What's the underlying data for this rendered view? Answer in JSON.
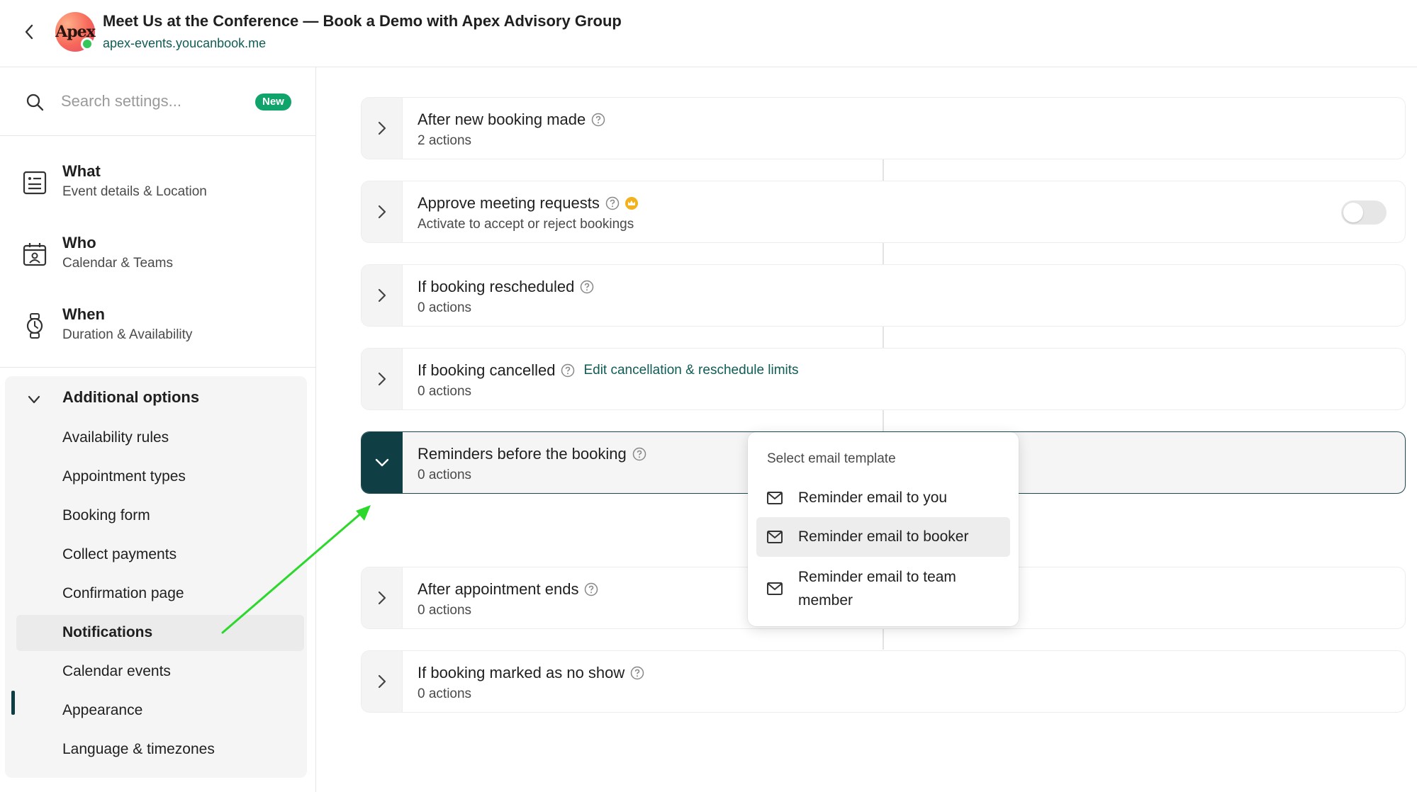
{
  "header": {
    "title": "Meet Us at the Conference — Book a Demo with Apex Advisory Group",
    "url": "apex-events.youcanbook.me",
    "avatar_text": "Apex"
  },
  "sidebar": {
    "search_placeholder": "Search settings...",
    "new_badge": "New",
    "main_items": [
      {
        "title": "What",
        "subtitle": "Event details & Location",
        "icon": "document-icon"
      },
      {
        "title": "Who",
        "subtitle": "Calendar & Teams",
        "icon": "calendar-user-icon"
      },
      {
        "title": "When",
        "subtitle": "Duration & Availability",
        "icon": "watch-icon"
      }
    ],
    "additional_label": "Additional options",
    "additional_items": [
      "Availability rules",
      "Appointment types",
      "Booking form",
      "Collect payments",
      "Confirmation page",
      "Notifications",
      "Calendar events",
      "Appearance",
      "Language & timezones"
    ],
    "active_item": "Notifications"
  },
  "workflows": [
    {
      "title": "After new booking made",
      "subtitle": "2 actions"
    },
    {
      "title": "Approve meeting requests",
      "subtitle": "Activate to accept or reject bookings",
      "toggle": false
    },
    {
      "title": "If booking rescheduled",
      "subtitle": "0 actions"
    },
    {
      "title": "If booking cancelled",
      "subtitle": "0 actions",
      "link": "Edit cancellation & reschedule limits"
    },
    {
      "title": "Reminders before the booking",
      "subtitle": "0 actions",
      "expanded": true
    },
    {
      "title": "After appointment ends",
      "subtitle": "0 actions"
    },
    {
      "title": "If booking marked as no show",
      "subtitle": "0 actions"
    }
  ],
  "dropdown": {
    "heading": "Select email template",
    "items": [
      "Reminder email to you",
      "Reminder email to booker",
      "Reminder email to team member"
    ],
    "hovered": "Reminder email to booker"
  },
  "colors": {
    "accent_dark": "#0f3f45",
    "link": "#0f5d55",
    "badge": "#10a36b",
    "annotation_arrow": "#2bd82b"
  }
}
